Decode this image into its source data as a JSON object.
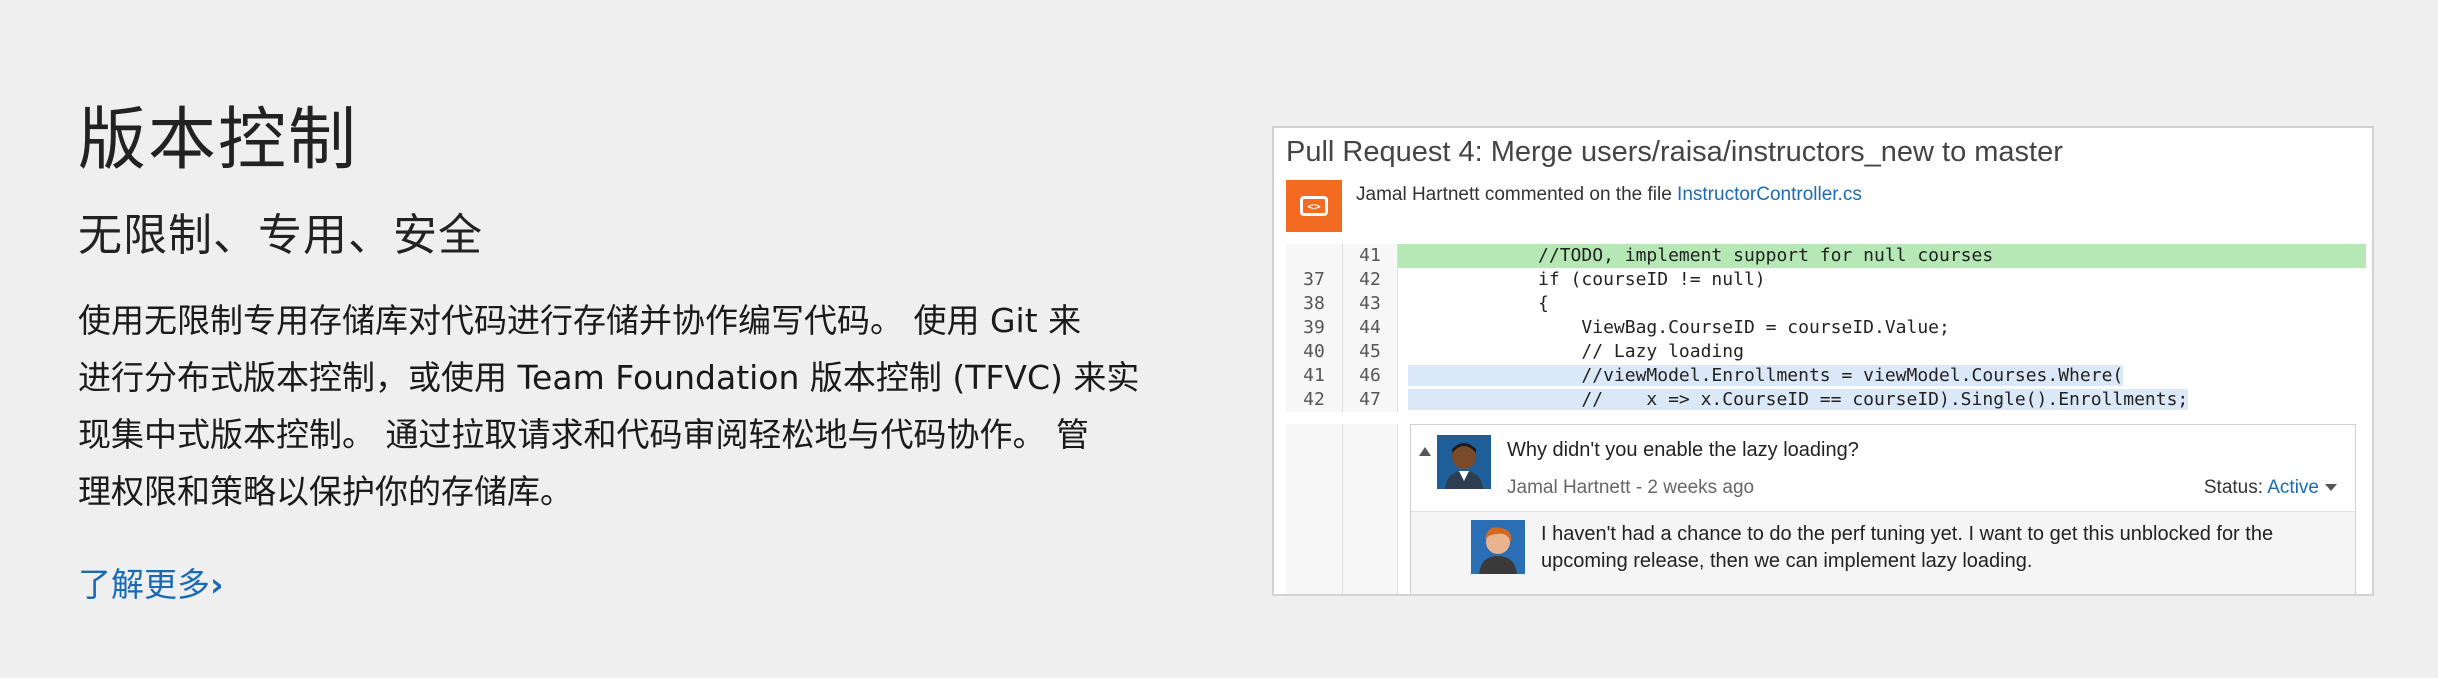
{
  "hero": {
    "title": "版本控制",
    "subtitle": "无限制、专用、安全",
    "description_lines": [
      "使用无限制专用存储库对代码进行存储并协作编写代码。 使用 Git 来",
      "进行分布式版本控制，或使用 Team Foundation 版本控制 (TFVC) 来实",
      "现集中式版本控制。 通过拉取请求和代码审阅轻松地与代码协作。 管",
      "理权限和策略以保护你的存储库。"
    ],
    "learn_more_label": "了解更多",
    "learn_more_chevron": "›"
  },
  "pull_request": {
    "title": "Pull Request 4: Merge users/raisa/instructors_new to master",
    "avatar_glyph": "<>",
    "commenter": "Jamal Hartnett commented on the file ",
    "file_name": "InstructorController.cs",
    "code_lines": [
      {
        "old": "",
        "new": "41",
        "text": "            //TODO, implement support for null courses",
        "state": "added"
      },
      {
        "old": "37",
        "new": "42",
        "text": "            if (courseID != null)",
        "state": "normal"
      },
      {
        "old": "38",
        "new": "43",
        "text": "            {",
        "state": "normal"
      },
      {
        "old": "39",
        "new": "44",
        "text": "                ViewBag.CourseID = courseID.Value;",
        "state": "normal"
      },
      {
        "old": "40",
        "new": "45",
        "text": "                // Lazy loading",
        "state": "normal"
      },
      {
        "old": "41",
        "new": "46",
        "text": "                //viewModel.Enrollments = viewModel.Courses.Where(",
        "state": "selected"
      },
      {
        "old": "42",
        "new": "47",
        "text": "                //    x => x.CourseID == courseID).Single().Enrollments;",
        "state": "selected"
      }
    ],
    "comment": {
      "text": "Why didn't you enable the lazy loading?",
      "author_meta": "Jamal Hartnett - 2 weeks ago",
      "status_label": "Status: ",
      "status_value": "Active"
    },
    "reply": {
      "line1": "I haven't had a chance to do the perf tuning yet.  I want to get this unblocked for the",
      "line2": "upcoming release, then we can implement lazy loading."
    }
  },
  "colors": {
    "accent": "#1a6bb5",
    "added_line": "#b5e8b5",
    "selected_line": "#dbe8f7",
    "avatar_orange": "#f26b21"
  }
}
